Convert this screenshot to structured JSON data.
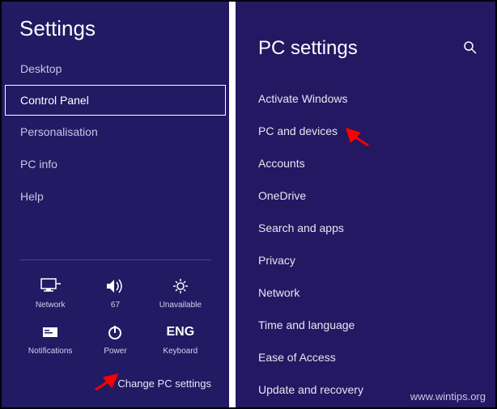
{
  "left": {
    "title": "Settings",
    "items": [
      {
        "label": "Desktop",
        "selected": false
      },
      {
        "label": "Control Panel",
        "selected": true
      },
      {
        "label": "Personalisation",
        "selected": false
      },
      {
        "label": "PC info",
        "selected": false
      },
      {
        "label": "Help",
        "selected": false
      }
    ],
    "tiles": {
      "network": "Network",
      "volume": "67",
      "brightness": "Unavailable",
      "notifications": "Notifications",
      "power": "Power",
      "keyboard_lang": "ENG",
      "keyboard": "Keyboard"
    },
    "change_link": "Change PC settings"
  },
  "right": {
    "title": "PC settings",
    "items": [
      "Activate Windows",
      "PC and devices",
      "Accounts",
      "OneDrive",
      "Search and apps",
      "Privacy",
      "Network",
      "Time and language",
      "Ease of Access",
      "Update and recovery"
    ]
  },
  "watermark": "www.wintips.org"
}
